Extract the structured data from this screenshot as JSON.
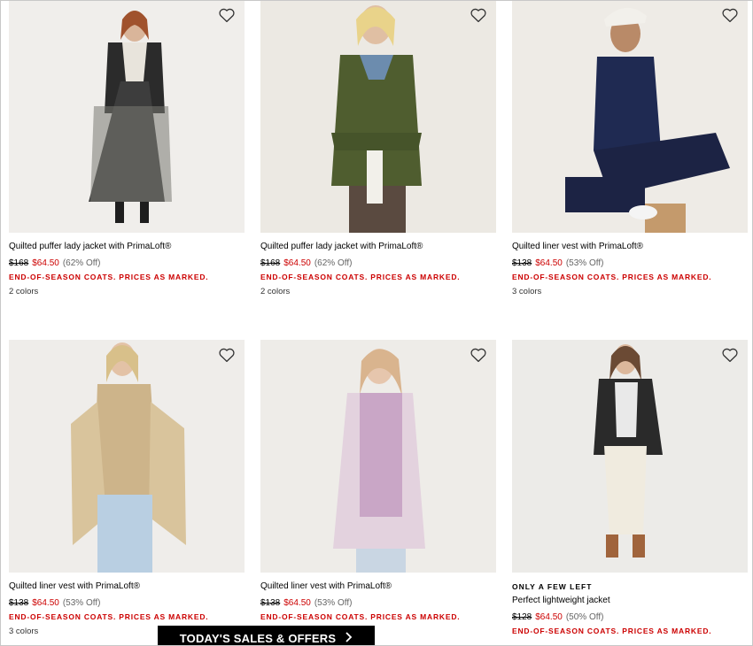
{
  "products": [
    {
      "name": "Quilted puffer lady jacket with PrimaLoft®",
      "was": "$168",
      "now": "$64.50",
      "pct": "(62% Off)",
      "promo": "END-OF-SEASON COATS. PRICES AS MARKED.",
      "colors": "2 colors"
    },
    {
      "name": "Quilted puffer lady jacket with PrimaLoft®",
      "was": "$168",
      "now": "$64.50",
      "pct": "(62% Off)",
      "promo": "END-OF-SEASON COATS. PRICES AS MARKED.",
      "colors": "2 colors"
    },
    {
      "name": "Quilted liner vest with PrimaLoft®",
      "was": "$138",
      "now": "$64.50",
      "pct": "(53% Off)",
      "promo": "END-OF-SEASON COATS. PRICES AS MARKED.",
      "colors": "3 colors"
    },
    {
      "name": "Quilted liner vest with PrimaLoft®",
      "was": "$138",
      "now": "$64.50",
      "pct": "(53% Off)",
      "promo": "END-OF-SEASON COATS. PRICES AS MARKED.",
      "colors": "3 colors"
    },
    {
      "name": "Quilted liner vest with PrimaLoft®",
      "was": "$138",
      "now": "$64.50",
      "pct": "(53% Off)",
      "promo": "END-OF-SEASON COATS. PRICES AS MARKED."
    },
    {
      "eyebrow": "ONLY A FEW LEFT",
      "name": "Perfect lightweight jacket",
      "was": "$128",
      "now": "$64.50",
      "pct": "(50% Off)",
      "promo": "END-OF-SEASON COATS. PRICES AS MARKED."
    }
  ],
  "sales_bar": {
    "label": "TODAY'S SALES & OFFERS",
    "icon": "chevron-right-icon"
  },
  "colors": {
    "sale_red": "#cc0000",
    "bar_bg": "#000000",
    "image_bg": "#f1efec"
  }
}
